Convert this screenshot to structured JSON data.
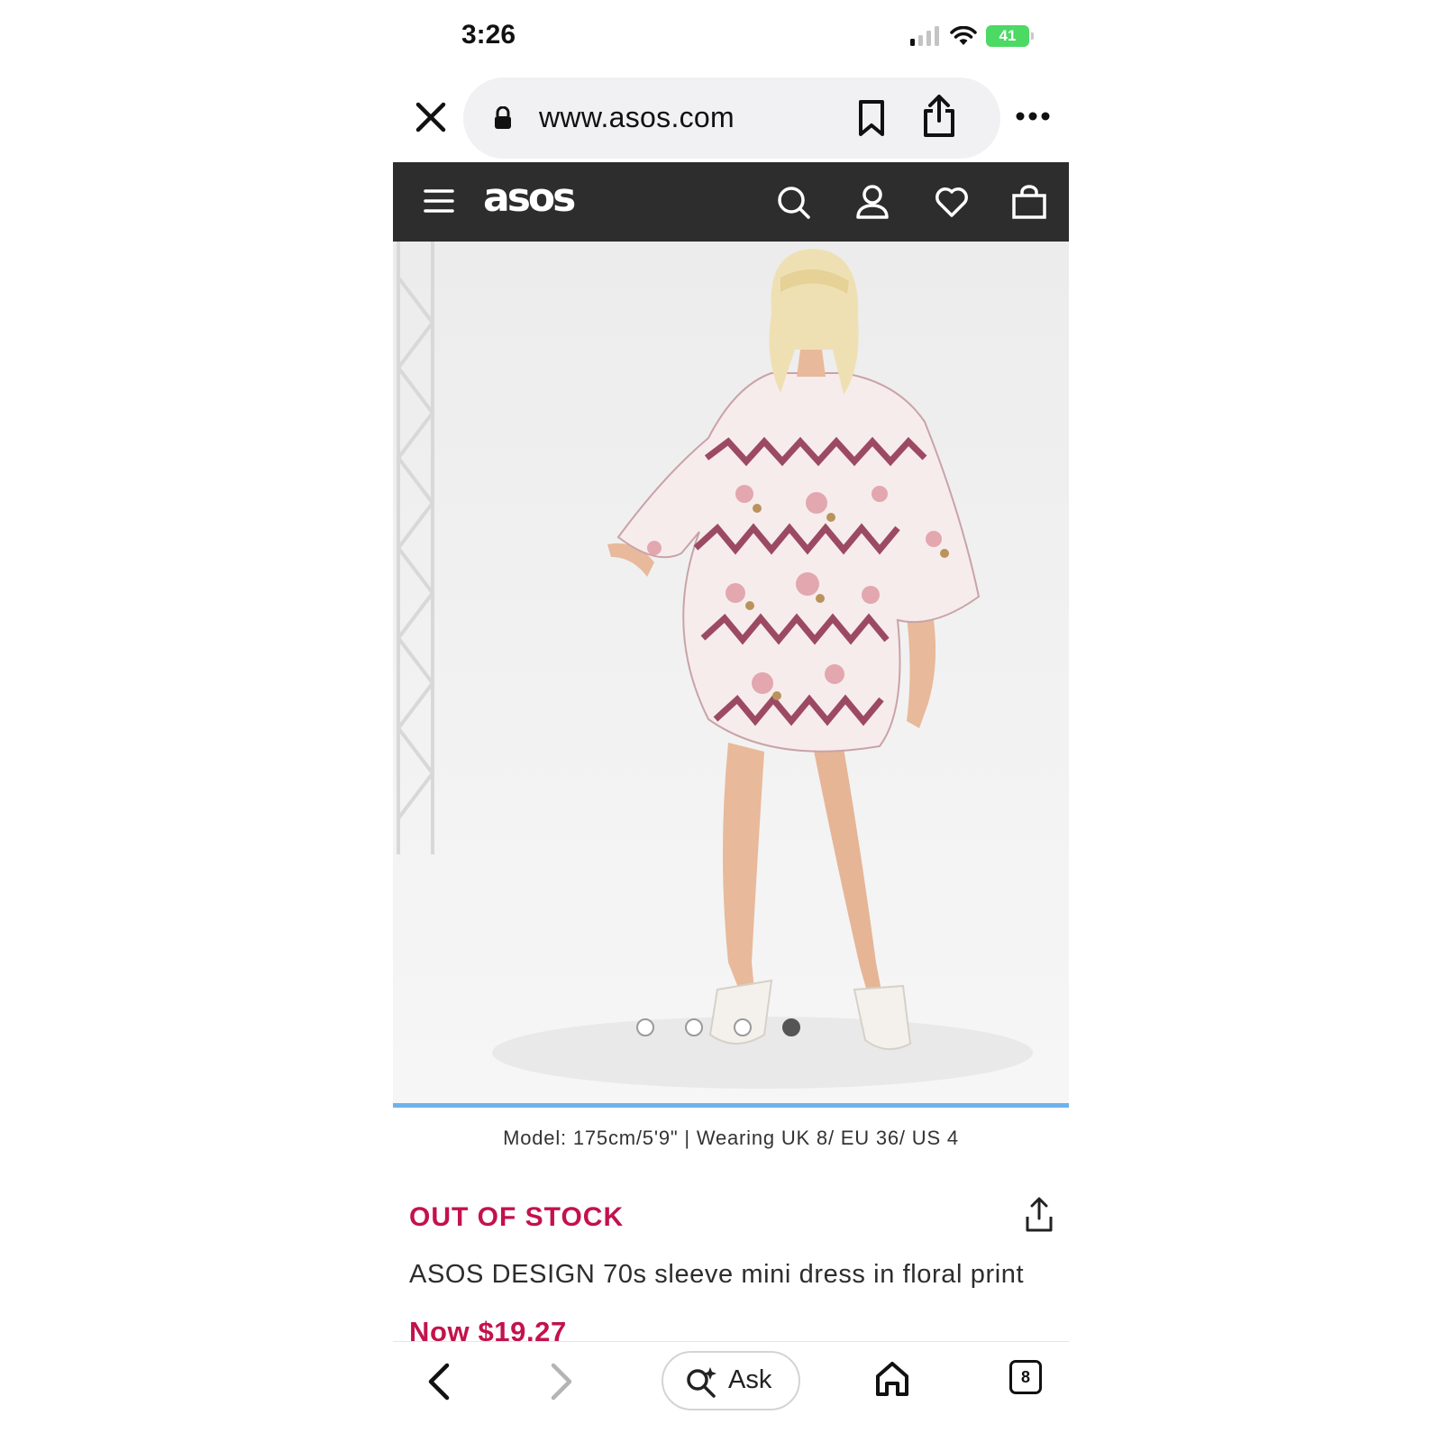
{
  "status_bar": {
    "time": "3:26",
    "battery": "41",
    "signal_icon": "cellular-signal-icon",
    "wifi_icon": "wifi-icon"
  },
  "browser": {
    "url": "www.asos.com",
    "close_icon": "close-icon",
    "lock_icon": "lock-icon",
    "bookmark_icon": "bookmark-icon",
    "share_icon": "share-icon",
    "more_icon": "more-icon"
  },
  "asos_header": {
    "logo": "asos",
    "menu_icon": "hamburger-menu-icon",
    "search_icon": "search-icon",
    "account_icon": "account-icon",
    "wishlist_icon": "heart-icon",
    "bag_icon": "shopping-bag-icon",
    "background_color": "#2d2d2d"
  },
  "gallery": {
    "image_count": 4,
    "active_index": 3,
    "photo_description_icon": "product-photo"
  },
  "product": {
    "model_info": "Model: 175cm/5'9\" | Wearing UK 8/ EU 36/ US 4",
    "stock_status": "OUT OF STOCK",
    "title": "ASOS DESIGN 70s sleeve mini dress in floral print",
    "price": "Now $19.27",
    "accent_color": "#c3124c"
  },
  "toolbar": {
    "ask_label": "Ask",
    "tab_count": "8",
    "back_icon": "chevron-left-icon",
    "forward_icon": "chevron-right-icon",
    "home_icon": "home-icon",
    "tabs_icon": "tabs-icon"
  }
}
